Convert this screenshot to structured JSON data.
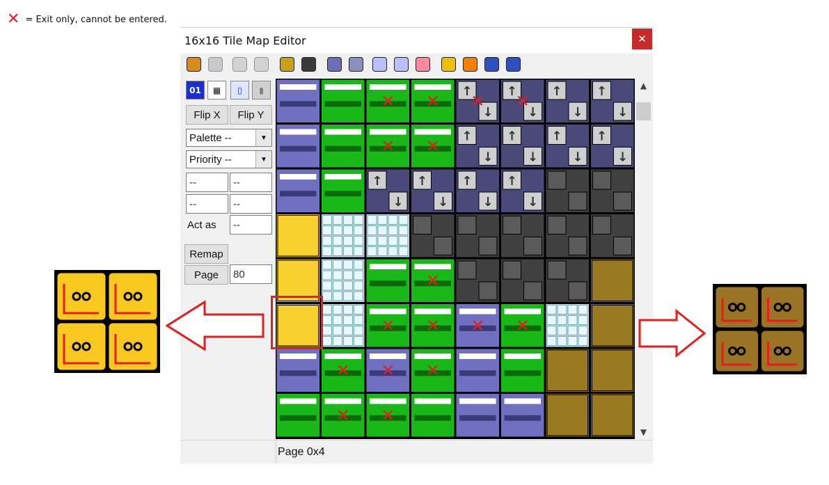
{
  "legend": {
    "symbol": "✕",
    "text": "= Exit only, cannot be entered."
  },
  "window": {
    "title": "16x16 Tile Map Editor",
    "close_glyph": "✕"
  },
  "toolbar": {
    "buttons": [
      {
        "name": "reload-icon",
        "color": "#d98a1c",
        "disabled": false
      },
      {
        "name": "save-icon",
        "color": "#9a9a9a",
        "disabled": true
      },
      {
        "name": "undo-icon",
        "color": "#b0b0b0",
        "disabled": true
      },
      {
        "name": "redo-icon",
        "color": "#b0b0b0",
        "disabled": true
      },
      {
        "name": "layer-1-icon",
        "color": "#caa21a",
        "disabled": false
      },
      {
        "name": "layer-2-icon",
        "color": "#3a3a3a",
        "disabled": false
      },
      {
        "name": "zoom-icon",
        "color": "#6a6fb5",
        "disabled": false
      },
      {
        "name": "barrel-icon",
        "color": "#8a8fc0",
        "disabled": false
      },
      {
        "name": "select-icon",
        "color": "#b8c0ff",
        "disabled": false
      },
      {
        "name": "delete-select-icon",
        "color": "#b8c0ff",
        "disabled": false
      },
      {
        "name": "paste-select-icon",
        "color": "#ff8aa0",
        "disabled": false
      },
      {
        "name": "help-yellow-icon",
        "color": "#f0c000",
        "disabled": false
      },
      {
        "name": "help-orange-icon",
        "color": "#f08000",
        "disabled": false
      },
      {
        "name": "help-blue-go-icon",
        "color": "#3050c0",
        "disabled": false
      },
      {
        "name": "help-blue-icon",
        "color": "#3050c0",
        "disabled": false
      }
    ]
  },
  "sidebar": {
    "mode_icons": [
      {
        "name": "hex-display-icon",
        "text": "01"
      },
      {
        "name": "grid-icon",
        "text": "▦"
      },
      {
        "name": "page-icon",
        "text": "▯"
      },
      {
        "name": "copy-icon",
        "text": "▮"
      }
    ],
    "flip_x": "Flip X",
    "flip_y": "Flip Y",
    "palette": "Palette --",
    "priority": "Priority --",
    "field_a1": "--",
    "field_a2": "--",
    "field_b1": "--",
    "field_b2": "--",
    "act_as_label": "Act as",
    "act_as_value": "--",
    "remap": "Remap",
    "page_button": "Page",
    "page_value": "80"
  },
  "scrollbar": {
    "up": "▲",
    "down": "▼"
  },
  "status": {
    "text": "Page 0x4"
  },
  "colors": {
    "accent_red": "#e41e1e",
    "close_red": "#c42b2b",
    "tile_yellow": "#f5c518",
    "tile_brown": "#8a6a14",
    "tile_green": "#18b818",
    "tile_purple": "#7070c0",
    "tile_lightblue": "#c0e0f8",
    "tile_dark": "#404040",
    "arrow_gray": "#9a9a9a"
  }
}
